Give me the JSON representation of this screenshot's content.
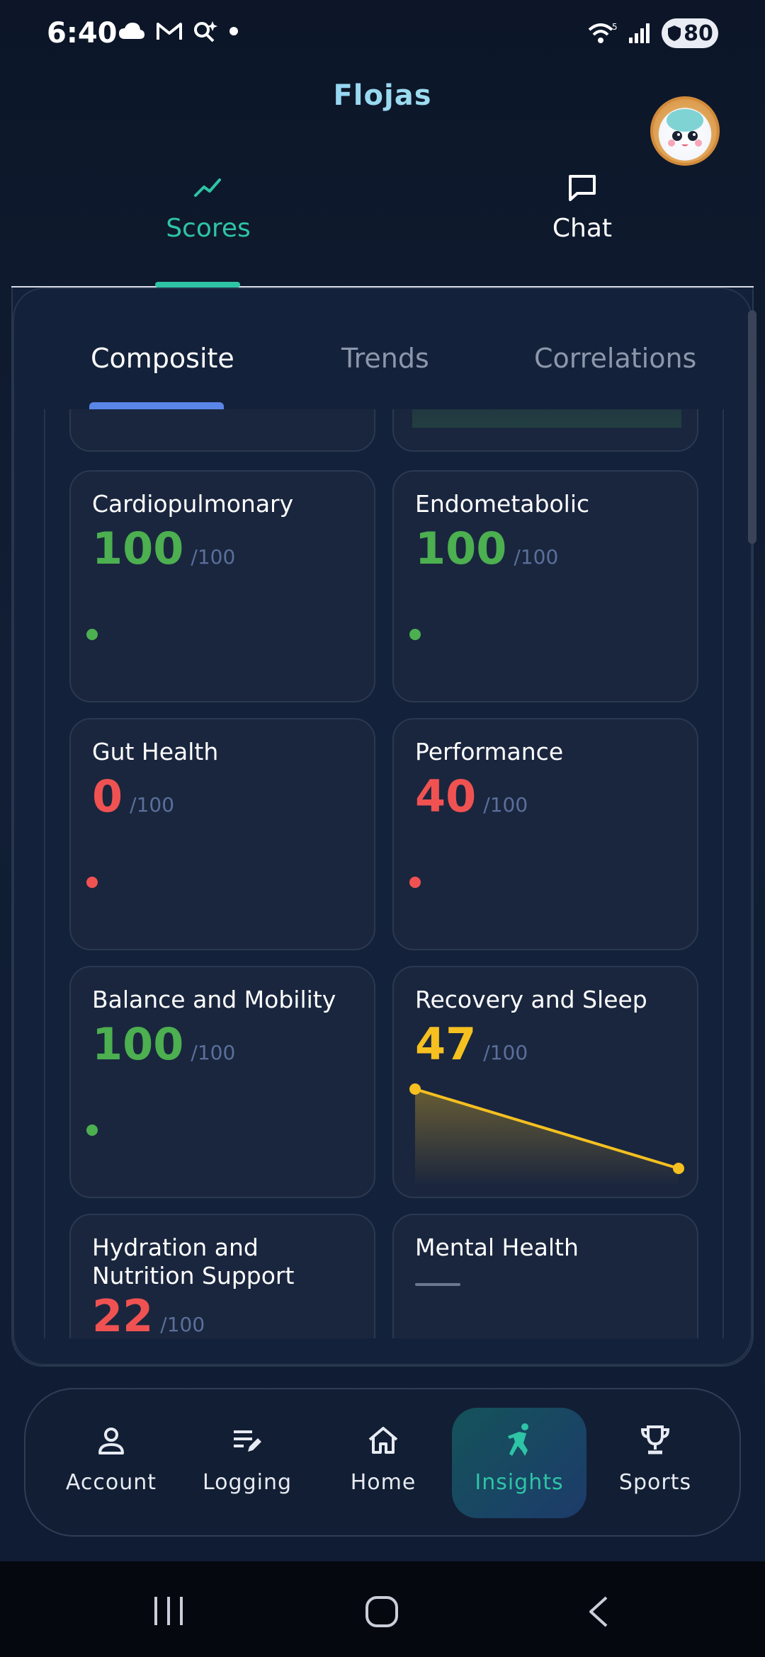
{
  "status_bar": {
    "time": "6:40",
    "battery": "80",
    "wifi_label": "5"
  },
  "app": {
    "title": "Flojas"
  },
  "top_tabs": [
    {
      "label": "Scores",
      "icon": "trend-line-icon",
      "active": true
    },
    {
      "label": "Chat",
      "icon": "chat-bubble-icon",
      "active": false
    }
  ],
  "sub_tabs": [
    {
      "label": "Composite",
      "active": true
    },
    {
      "label": "Trends",
      "active": false
    },
    {
      "label": "Correlations",
      "active": false
    }
  ],
  "cards": [
    {
      "title": "Cardiopulmonary",
      "score": "100",
      "max": "/100",
      "color": "#4caf50"
    },
    {
      "title": "Endometabolic",
      "score": "100",
      "max": "/100",
      "color": "#4caf50"
    },
    {
      "title": "Gut Health",
      "score": "0",
      "max": "/100",
      "color": "#f05252"
    },
    {
      "title": "Performance",
      "score": "40",
      "max": "/100",
      "color": "#f05252"
    },
    {
      "title": "Balance and Mobility",
      "score": "100",
      "max": "/100",
      "color": "#4caf50"
    },
    {
      "title": "Recovery and Sleep",
      "score": "47",
      "max": "/100",
      "color": "#f5c020"
    },
    {
      "title": "Hydration and Nutrition Support",
      "score": "22",
      "max": "/100",
      "color": "#f05252"
    },
    {
      "title": "Mental Health",
      "score": "",
      "max": "",
      "color": "#6c7890"
    }
  ],
  "bottom_nav": [
    {
      "label": "Account",
      "icon": "person-icon",
      "active": false
    },
    {
      "label": "Logging",
      "icon": "edit-list-icon",
      "active": false
    },
    {
      "label": "Home",
      "icon": "home-icon",
      "active": false
    },
    {
      "label": "Insights",
      "icon": "runner-icon",
      "active": true
    },
    {
      "label": "Sports",
      "icon": "trophy-icon",
      "active": false
    }
  ],
  "colors": {
    "accent": "#2ec4a6",
    "sub_tab_accent": "#5a86e8",
    "good": "#4caf50",
    "bad": "#f05252",
    "warn": "#f5c020"
  }
}
